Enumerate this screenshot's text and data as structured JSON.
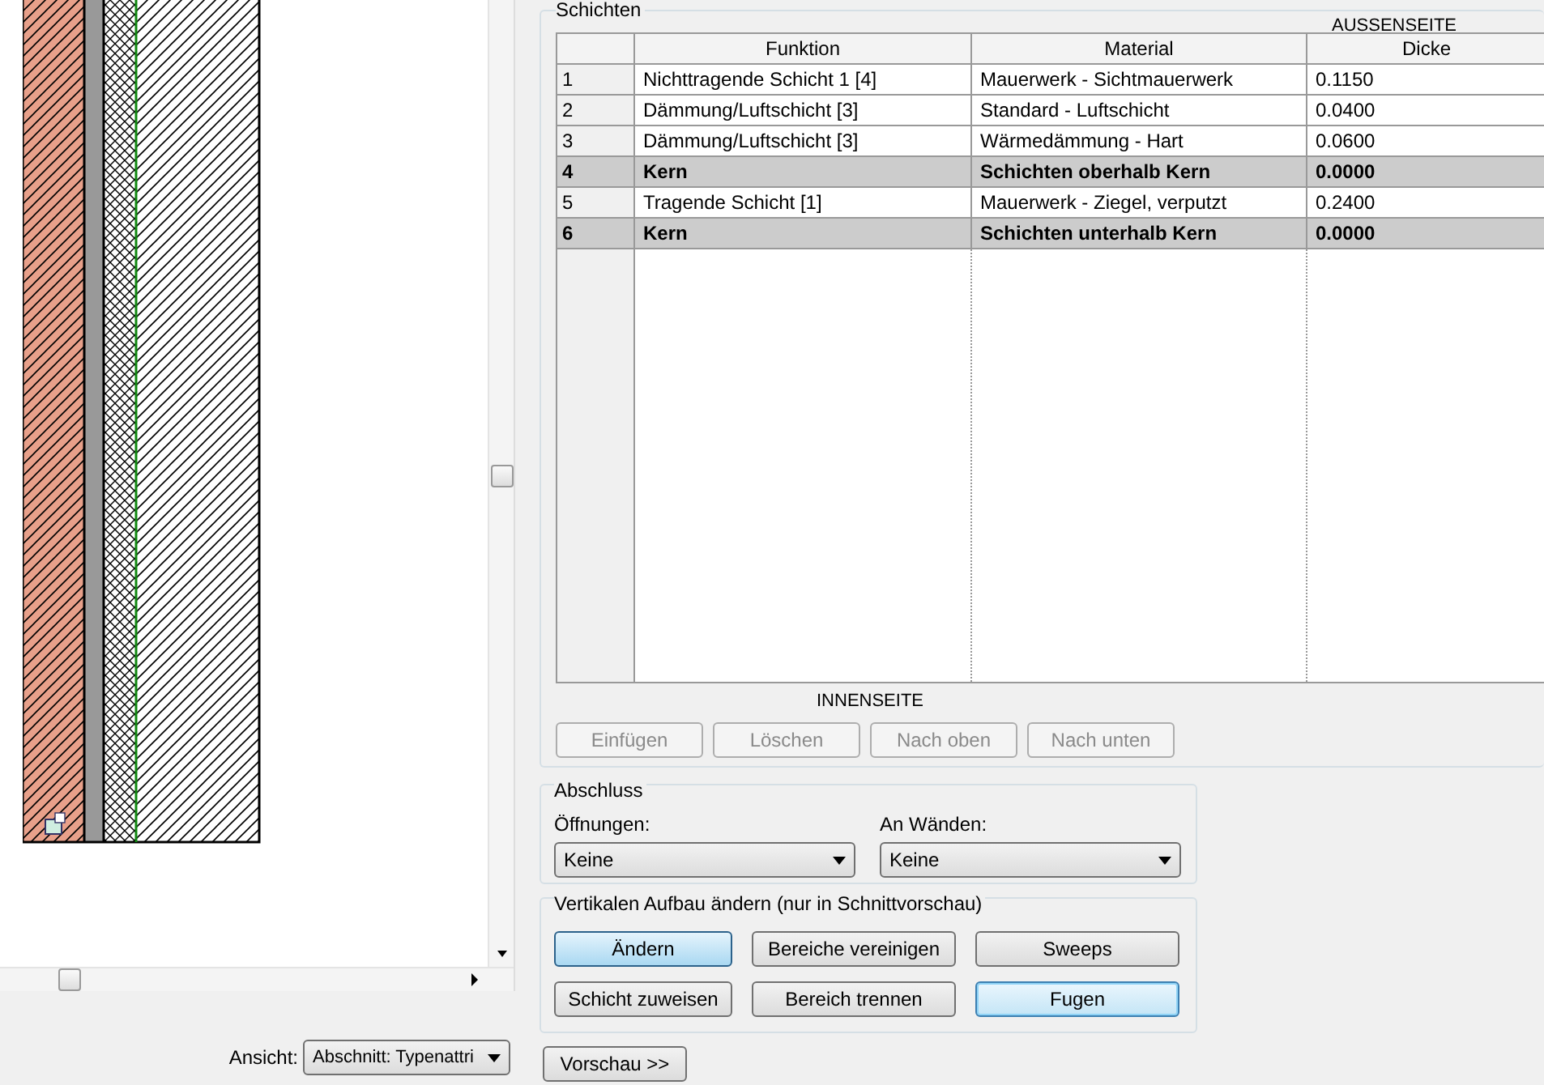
{
  "preview": {
    "view_label": "Ansicht:",
    "view_select": "Abschnitt: Typenattri"
  },
  "layers": {
    "title": "Schichten",
    "outer_label": "AUSSENSEITE",
    "inner_label": "INNENSEITE",
    "table": {
      "columns": [
        "Funktion",
        "Material",
        "Dicke"
      ],
      "rows": [
        {
          "number": "1",
          "function": "Nichttragende Schicht 1 [4]",
          "material": "Mauerwerk - Sichtmauerwerk",
          "thickness": "0.1150",
          "core": false
        },
        {
          "number": "2",
          "function": "Dämmung/Luftschicht [3]",
          "material": "Standard - Luftschicht",
          "thickness": "0.0400",
          "core": false
        },
        {
          "number": "3",
          "function": "Dämmung/Luftschicht [3]",
          "material": "Wärmedämmung - Hart",
          "thickness": "0.0600",
          "core": false
        },
        {
          "number": "4",
          "function": "Kern",
          "material": "Schichten oberhalb Kern",
          "thickness": "0.0000",
          "core": true
        },
        {
          "number": "5",
          "function": "Tragende Schicht [1]",
          "material": "Mauerwerk - Ziegel, verputzt",
          "thickness": "0.2400",
          "core": false
        },
        {
          "number": "6",
          "function": "Kern",
          "material": "Schichten unterhalb Kern",
          "thickness": "0.0000",
          "core": true
        }
      ]
    },
    "buttons": [
      {
        "label": "Einfügen",
        "disabled": true
      },
      {
        "label": "Löschen",
        "disabled": true
      },
      {
        "label": "Nach oben",
        "disabled": true
      },
      {
        "label": "Nach unten",
        "disabled": true
      }
    ]
  },
  "wrap": {
    "title": "Abschluss",
    "fields": [
      {
        "label": "Öffnungen:",
        "value": "Keine"
      },
      {
        "label": "An Wänden:",
        "value": "Keine"
      }
    ]
  },
  "vertical": {
    "title": "Vertikalen Aufbau ändern (nur in Schnittvorschau)",
    "buttons": [
      {
        "label": "Ändern",
        "pressed": true,
        "focused": false
      },
      {
        "label": "Bereiche vereinigen",
        "pressed": false,
        "focused": false
      },
      {
        "label": "Sweeps",
        "pressed": false,
        "focused": false
      },
      {
        "label": "Schicht zuweisen",
        "pressed": false,
        "focused": false
      },
      {
        "label": "Bereich trennen",
        "pressed": false,
        "focused": false
      },
      {
        "label": "Fugen",
        "pressed": false,
        "focused": true
      }
    ]
  },
  "preview_button": "Vorschau >>"
}
